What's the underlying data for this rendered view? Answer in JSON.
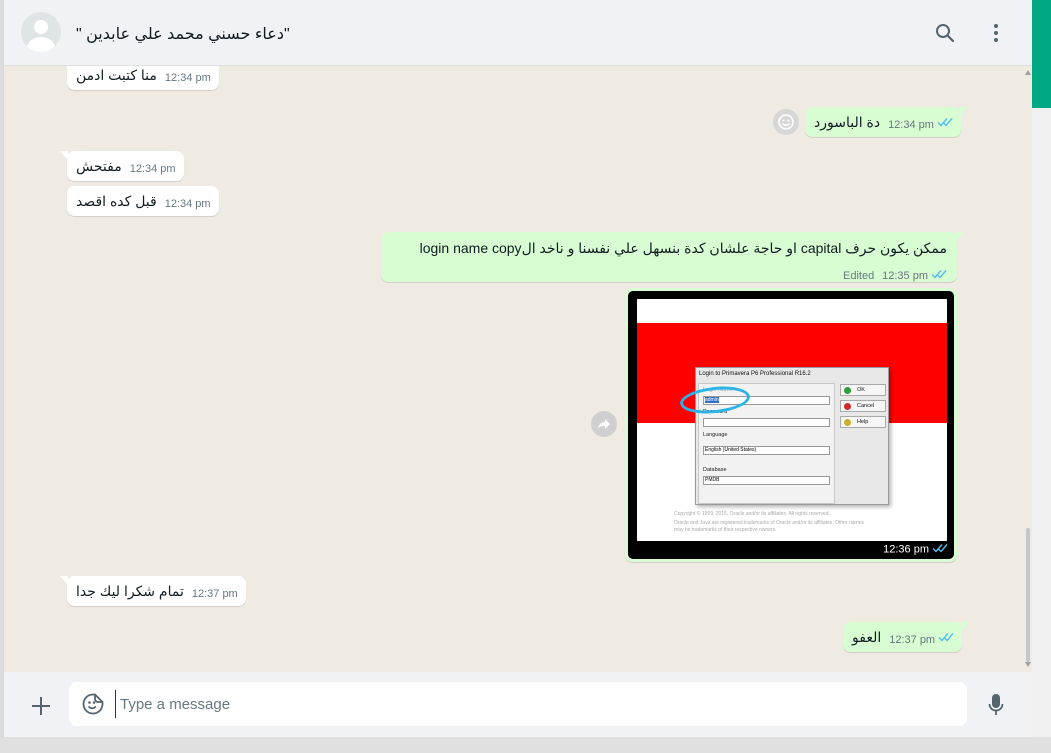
{
  "header": {
    "contact_name": "\"دعاء حسني محمد علي عابدين \""
  },
  "messages": [
    {
      "id": "m1",
      "direction": "in",
      "text": "منا كتبت ادمن",
      "time": "12:34 pm"
    },
    {
      "id": "m2",
      "direction": "out",
      "text": "دة الباسورد",
      "time": "12:34 pm",
      "status": "read"
    },
    {
      "id": "m3",
      "direction": "in",
      "text": "مفتحش",
      "time": "12:34 pm"
    },
    {
      "id": "m4",
      "direction": "in",
      "text": "قبل كده اقصد",
      "time": "12:34 pm"
    },
    {
      "id": "m5",
      "direction": "out",
      "text": "ممكن يكون حرف capital او حاجة علشان كدة بنسهل علي نفسنا و ناخد الlogin name copy",
      "edited_label": "Edited",
      "time": "12:35 pm",
      "status": "read"
    },
    {
      "id": "m6",
      "direction": "out",
      "type": "image",
      "time": "12:36 pm",
      "status": "read"
    },
    {
      "id": "m7",
      "direction": "in",
      "text": "تمام شكرا ليك جدا",
      "time": "12:37 pm"
    },
    {
      "id": "m8",
      "direction": "out",
      "text": "العفو",
      "time": "12:37 pm",
      "status": "read"
    }
  ],
  "screenshot_image": {
    "dialog_title": "Login to Primavera P6 Professional R16.2",
    "login_label": "Login Name",
    "login_value": "admin",
    "password_label": "Password",
    "language_label": "Language",
    "language_value": "English (United States)",
    "database_label": "Database",
    "database_value": "PMDB",
    "ok_label": "OK",
    "cancel_label": "Cancel",
    "help_label": "Help",
    "copyright_1": "Copyright © 1999, 2016, Oracle and/or its affiliates. All rights reserved.",
    "copyright_2": "Oracle and Java are registered trademarks of Oracle and/or its affiliates. Other names",
    "copyright_3": "may be trademarks of their respective owners."
  },
  "composer": {
    "placeholder": "Type a message"
  },
  "colors": {
    "outgoing_bubble": "#d9fdd3",
    "incoming_bubble": "#ffffff",
    "read_ticks": "#53bdeb",
    "accent": "#00a884"
  }
}
